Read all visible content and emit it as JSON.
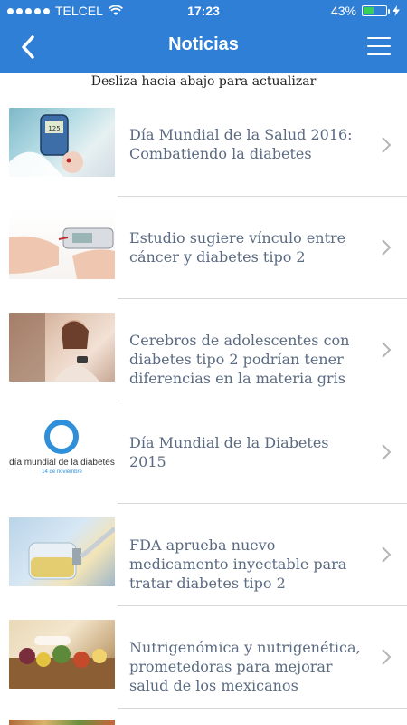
{
  "status_bar": {
    "carrier": "TELCEL",
    "time": "17:23",
    "battery_percent": "43%",
    "battery_level": 0.43,
    "signal_bars": 5,
    "wifi_icon": "wifi-icon",
    "charging_icon": "lightning-icon"
  },
  "nav": {
    "title": "Noticias",
    "back_icon": "chevron-left-icon",
    "menu_icon": "hamburger-menu-icon"
  },
  "refresh_hint": "Desliza hacia abajo para actualizar",
  "news": [
    {
      "title": "Día Mundial de la Salud 2016: Combatiendo la diabetes"
    },
    {
      "title": "Estudio sugiere vínculo entre cáncer y diabetes tipo 2"
    },
    {
      "title": "Cerebros de adolescentes con diabetes tipo 2 podrían tener diferencias en la materia gris"
    },
    {
      "title": "Día Mundial de la Diabetes 2015",
      "thumb_text": "día mundial de la diabetes",
      "thumb_subtext": "14 de noviembre"
    },
    {
      "title": "FDA aprueba nuevo medicamento inyectable para tratar diabetes tipo 2"
    },
    {
      "title": "Nutrigenómica y nutrigenética, prometedoras para mejorar salud de los mexicanos"
    }
  ],
  "colors": {
    "header": "#2f7fd6",
    "title_text": "#5b6b82",
    "separator": "#d8d8d8",
    "chevron": "#b5b5b5"
  }
}
